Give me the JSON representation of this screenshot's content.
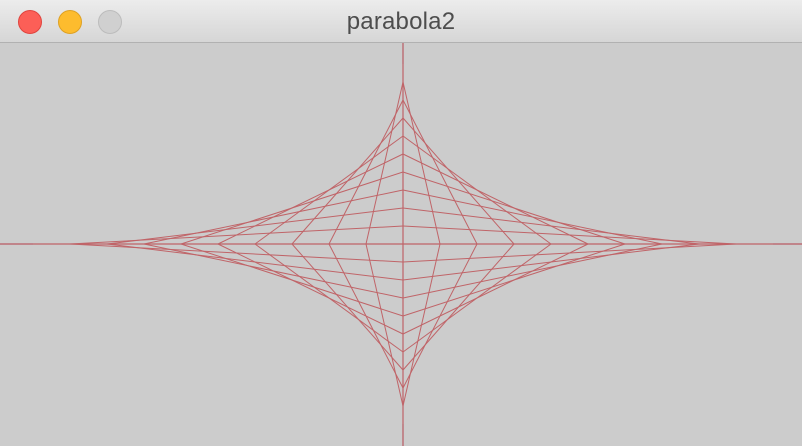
{
  "window": {
    "title": "parabola2",
    "controls": {
      "close": "close-button",
      "minimize": "minimize-button",
      "zoom": "zoom-button"
    }
  },
  "sketch": {
    "background_color": "#cccccc",
    "line_color": "#c06468",
    "axis_color": "#b85a63",
    "steps": 10
  }
}
